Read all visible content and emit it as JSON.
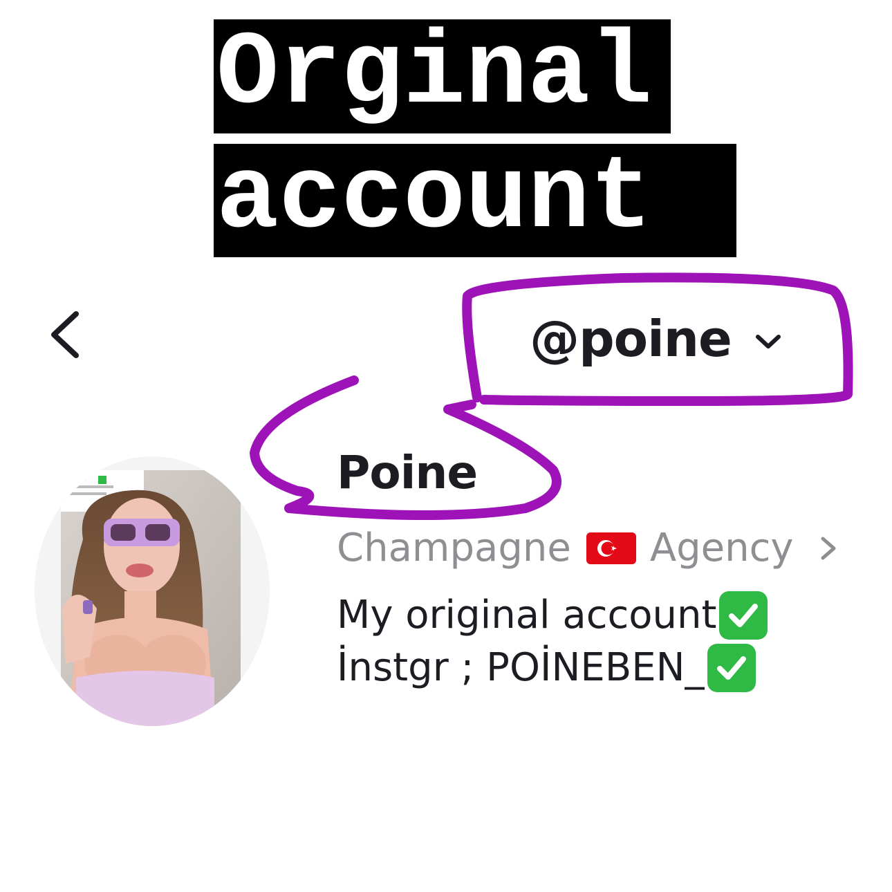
{
  "caption": {
    "line1": "Orginal",
    "line2": "account"
  },
  "header": {
    "back_icon": "chevron-left-icon",
    "username": "@poine",
    "dropdown_icon": "chevron-down-icon"
  },
  "profile": {
    "display_name": "Poine",
    "agency": {
      "prefix": "Champagne",
      "flag": "turkey-flag-icon",
      "suffix": "Agency",
      "arrow_icon": "chevron-right-icon"
    },
    "bio": {
      "line1": "My original account",
      "line2": "İnstgr ; POİNEBEN_",
      "check_icon": "check-mark-button-icon"
    }
  },
  "colors": {
    "annotation": "#9e13b8",
    "secondary_text": "#8e8e93",
    "check_green": "#2fb945",
    "flag_red": "#e30a17"
  }
}
